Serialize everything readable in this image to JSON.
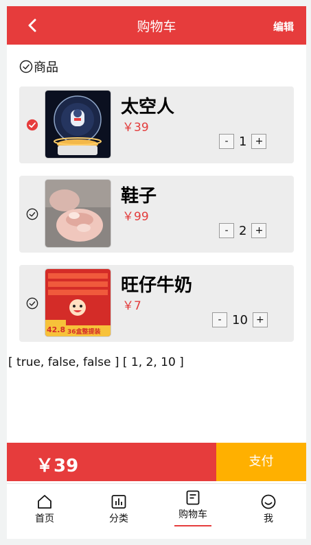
{
  "header": {
    "title": "购物车",
    "edit_label": "编辑"
  },
  "select_all": {
    "label": "商品",
    "checked": false
  },
  "items": [
    {
      "name": "太空人",
      "price": "￥39",
      "qty": "1",
      "checked": true,
      "thumb": "astronaut-lamp"
    },
    {
      "name": "鞋子",
      "price": "￥99",
      "qty": "2",
      "checked": false,
      "thumb": "pink-slippers"
    },
    {
      "name": "旺仔牛奶",
      "price": "￥7",
      "qty": "10",
      "checked": false,
      "thumb": "wangzai-milk"
    }
  ],
  "qty_controls": {
    "minus": "-",
    "plus": "+"
  },
  "debug_text": "[ true, false, false ] [ 1, 2, 10 ]",
  "footer": {
    "total": "￥39",
    "pay_label": "支付"
  },
  "tabs": [
    {
      "label": "首页",
      "icon": "home-icon"
    },
    {
      "label": "分类",
      "icon": "chart-icon"
    },
    {
      "label": "购物车",
      "icon": "cart-doc-icon",
      "active": true
    },
    {
      "label": "我",
      "icon": "smile-icon"
    }
  ],
  "thumb_texts": {
    "milk_price": "42.8",
    "milk_promo": "36盒整提装"
  },
  "colors": {
    "primary": "#e63c3c",
    "pay": "#ffb000",
    "item_bg": "#ededed"
  }
}
